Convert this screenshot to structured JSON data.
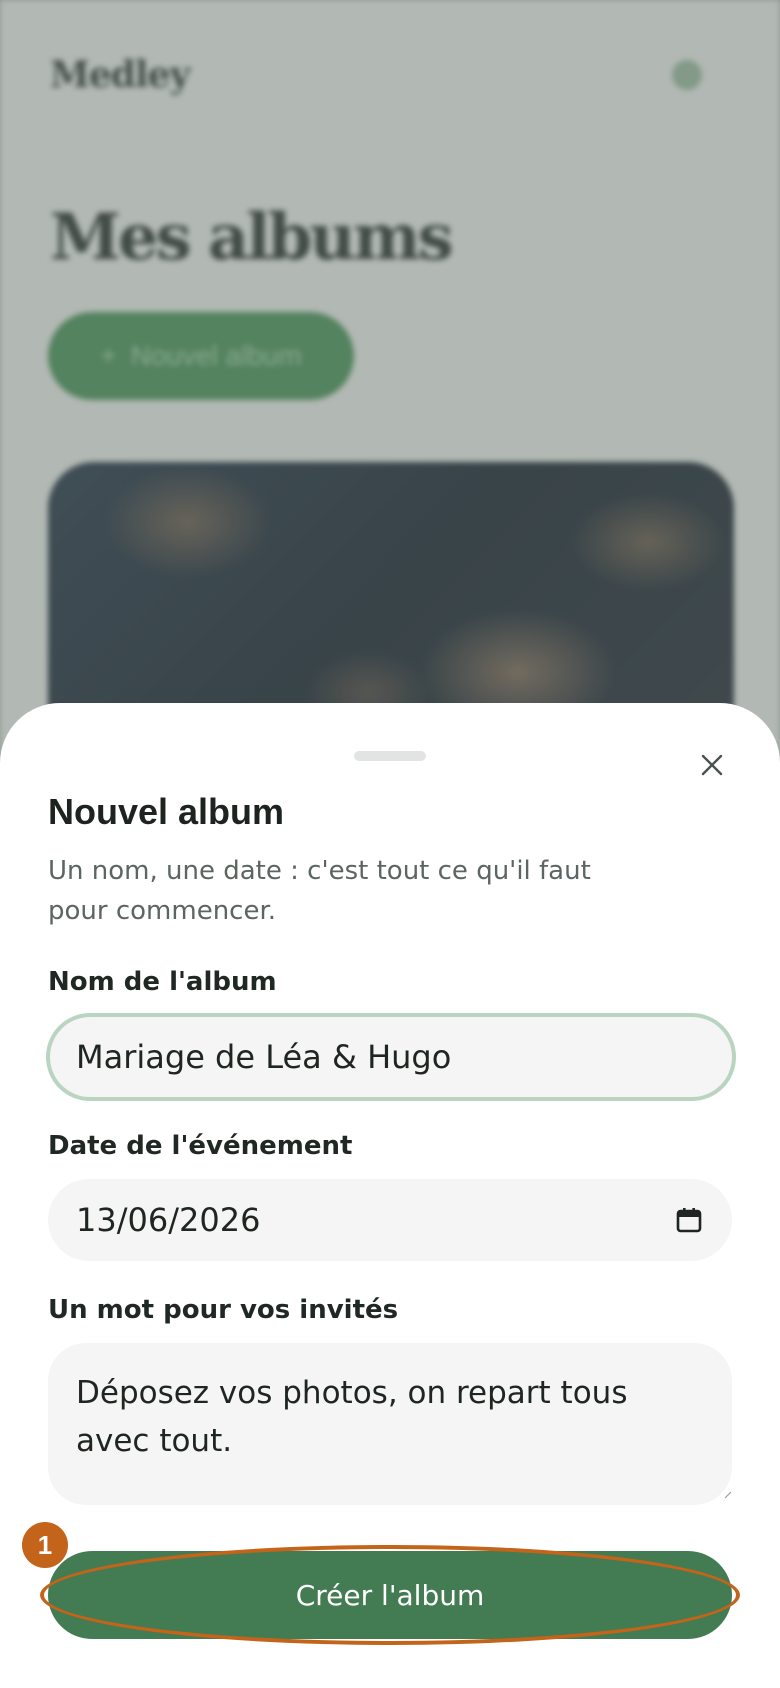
{
  "background": {
    "logo": "Medley",
    "title": "Mes albums",
    "new_album_button": "Nouvel album",
    "menu_icon": "menu-icon"
  },
  "sheet": {
    "title": "Nouvel album",
    "subtitle": "Un nom, une date : c'est tout ce qu'il faut pour commencer.",
    "close_icon": "close-icon",
    "name_label": "Nom de l'album",
    "name_value": "Mariage de Léa & Hugo",
    "date_label": "Date de l'événement",
    "date_value": "13/06/2026",
    "date_icon": "calendar-icon",
    "message_label": "Un mot pour vos invités",
    "message_value": "Déposez vos photos, on repart tous avec tout.",
    "create_button": "Créer l'album"
  },
  "annotation": {
    "step_number": "1",
    "color": "#c4641a"
  },
  "colors": {
    "primary_green": "#437b52",
    "focus_ring": "#b9d4c0"
  }
}
